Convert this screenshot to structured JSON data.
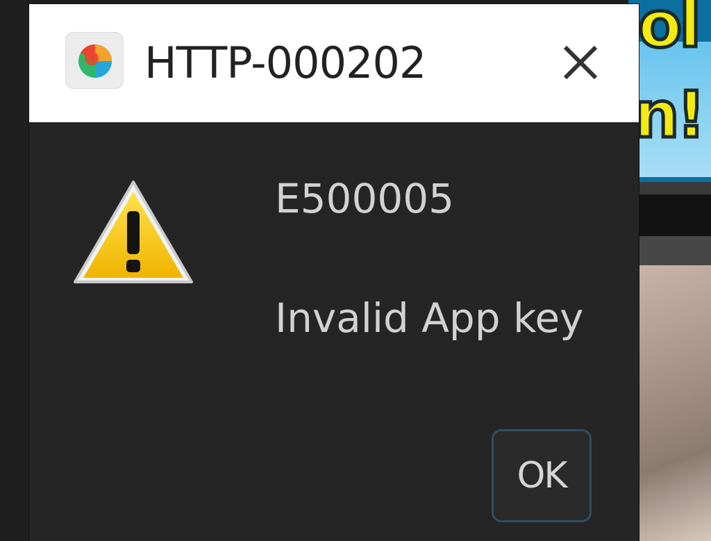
{
  "dialog": {
    "title": "HTTP-000202",
    "error_code": "E500005",
    "message": "Invalid App key",
    "ok_label": "OK",
    "app_icon": "app-logo-icon",
    "warning_icon": "warning-icon",
    "close_icon": "close-icon"
  },
  "colors": {
    "dialog_background": "#252525",
    "titlebar_background": "#ffffff",
    "text": "#d2d2d2",
    "title_text": "#222222",
    "ok_border": "#2f4f63",
    "warning_yellow": "#f2c40f"
  }
}
